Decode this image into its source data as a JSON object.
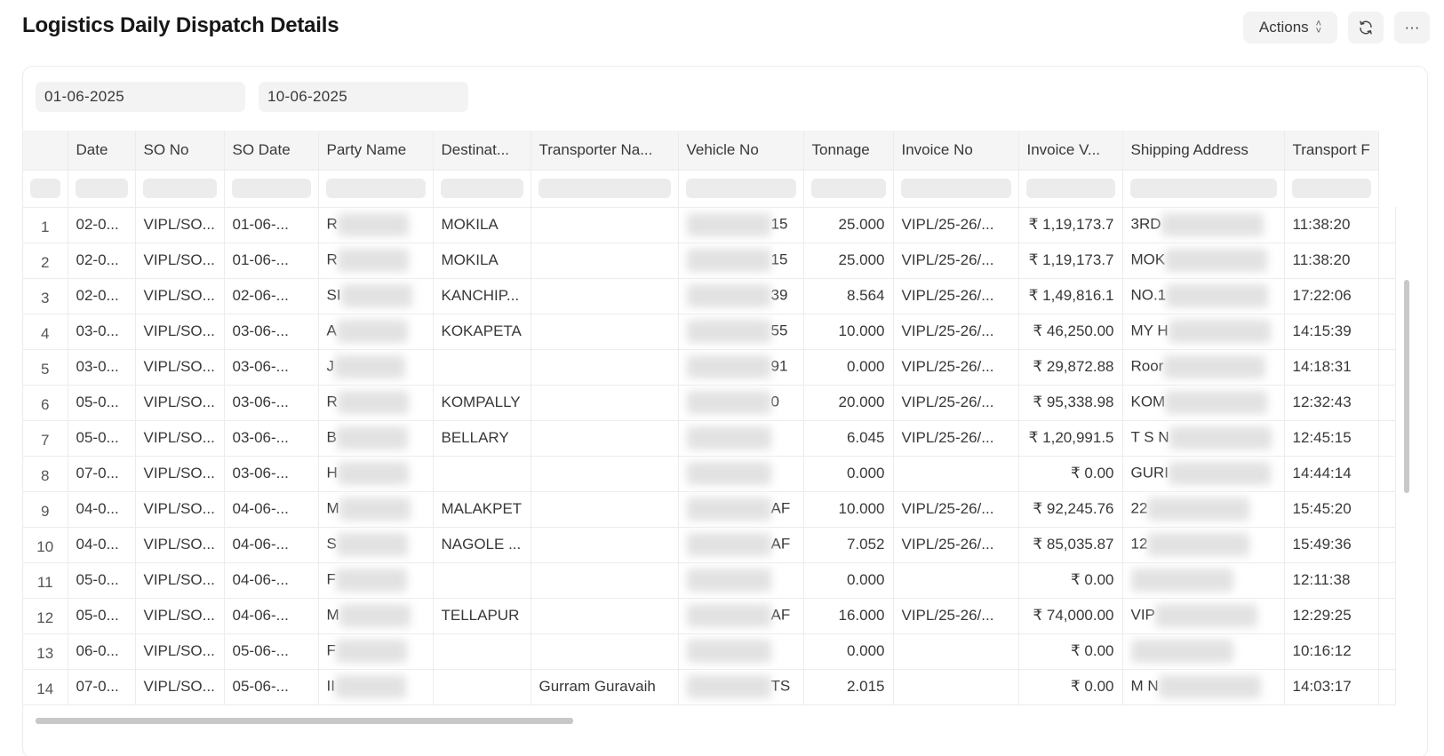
{
  "page": {
    "title": "Logistics Daily Dispatch Details"
  },
  "toolbar": {
    "actions_label": "Actions",
    "refresh_icon": "refresh-icon",
    "more_label": "···"
  },
  "filters": {
    "from_date": "01-06-2025",
    "to_date": "10-06-2025"
  },
  "columns": [
    "Date",
    "SO No",
    "SO Date",
    "Party Name",
    "Destinat...",
    "Transporter Na...",
    "Vehicle No",
    "Tonnage",
    "Invoice No",
    "Invoice V...",
    "Shipping Address",
    "Transport F"
  ],
  "rows": [
    {
      "idx": "1",
      "date": "02-0...",
      "so_no": "VIPL/SO...",
      "so_date": "01-06-...",
      "party": "R",
      "dest": "MOKILA",
      "transporter": "",
      "vehicle": "15",
      "tonnage": "25.000",
      "invoice_no": "VIPL/25-26/...",
      "invoice_val": "₹ 1,19,173.7",
      "address": "3RD",
      "time": "11:38:20"
    },
    {
      "idx": "2",
      "date": "02-0...",
      "so_no": "VIPL/SO...",
      "so_date": "01-06-...",
      "party": "R",
      "dest": "MOKILA",
      "transporter": "",
      "vehicle": "15",
      "tonnage": "25.000",
      "invoice_no": "VIPL/25-26/...",
      "invoice_val": "₹ 1,19,173.7",
      "address": "MOK",
      "time": "11:38:20"
    },
    {
      "idx": "3",
      "date": "02-0...",
      "so_no": "VIPL/SO...",
      "so_date": "02-06-...",
      "party": "SI",
      "dest": "KANCHIP...",
      "transporter": "",
      "vehicle": "39",
      "tonnage": "8.564",
      "invoice_no": "VIPL/25-26/...",
      "invoice_val": "₹ 1,49,816.1",
      "address": "NO.1",
      "time": "17:22:06"
    },
    {
      "idx": "4",
      "date": "03-0...",
      "so_no": "VIPL/SO...",
      "so_date": "03-06-...",
      "party": "A",
      "dest": "KOKAPETA",
      "transporter": "",
      "vehicle": "55",
      "tonnage": "10.000",
      "invoice_no": "VIPL/25-26/...",
      "invoice_val": "₹ 46,250.00",
      "address": "MY H",
      "time": "14:15:39"
    },
    {
      "idx": "5",
      "date": "03-0...",
      "so_no": "VIPL/SO...",
      "so_date": "03-06-...",
      "party": "J",
      "dest": "",
      "transporter": "",
      "vehicle": "91",
      "tonnage": "0.000",
      "invoice_no": "VIPL/25-26/...",
      "invoice_val": "₹ 29,872.88",
      "address": "Roor",
      "time": "14:18:31"
    },
    {
      "idx": "6",
      "date": "05-0...",
      "so_no": "VIPL/SO...",
      "so_date": "03-06-...",
      "party": "R",
      "dest": "KOMPALLY",
      "transporter": "",
      "vehicle": "0",
      "tonnage": "20.000",
      "invoice_no": "VIPL/25-26/...",
      "invoice_val": "₹ 95,338.98",
      "address": "KOM",
      "time": "12:32:43"
    },
    {
      "idx": "7",
      "date": "05-0...",
      "so_no": "VIPL/SO...",
      "so_date": "03-06-...",
      "party": "B",
      "dest": "BELLARY",
      "transporter": "",
      "vehicle": "",
      "tonnage": "6.045",
      "invoice_no": "VIPL/25-26/...",
      "invoice_val": "₹ 1,20,991.5",
      "address": "T S N",
      "time": "12:45:15"
    },
    {
      "idx": "8",
      "date": "07-0...",
      "so_no": "VIPL/SO...",
      "so_date": "03-06-...",
      "party": "H",
      "dest": "",
      "transporter": "",
      "vehicle": "",
      "tonnage": "0.000",
      "invoice_no": "",
      "invoice_val": "₹ 0.00",
      "address": "GURI",
      "time": "14:44:14"
    },
    {
      "idx": "9",
      "date": "04-0...",
      "so_no": "VIPL/SO...",
      "so_date": "04-06-...",
      "party": "M",
      "dest": "MALAKPET",
      "transporter": "",
      "vehicle": "AF",
      "tonnage": "10.000",
      "invoice_no": "VIPL/25-26/...",
      "invoice_val": "₹ 92,245.76",
      "address": "22",
      "time": "15:45:20"
    },
    {
      "idx": "10",
      "date": "04-0...",
      "so_no": "VIPL/SO...",
      "so_date": "04-06-...",
      "party": "S",
      "dest": "NAGOLE ...",
      "transporter": "",
      "vehicle": "AF",
      "tonnage": "7.052",
      "invoice_no": "VIPL/25-26/...",
      "invoice_val": "₹ 85,035.87",
      "address": "12",
      "time": "15:49:36"
    },
    {
      "idx": "11",
      "date": "05-0...",
      "so_no": "VIPL/SO...",
      "so_date": "04-06-...",
      "party": "F",
      "dest": "",
      "transporter": "",
      "vehicle": "",
      "tonnage": "0.000",
      "invoice_no": "",
      "invoice_val": "₹ 0.00",
      "address": "",
      "time": "12:11:38"
    },
    {
      "idx": "12",
      "date": "05-0...",
      "so_no": "VIPL/SO...",
      "so_date": "04-06-...",
      "party": "M",
      "dest": "TELLAPUR",
      "transporter": "",
      "vehicle": "AF",
      "tonnage": "16.000",
      "invoice_no": "VIPL/25-26/...",
      "invoice_val": "₹ 74,000.00",
      "address": "VIP",
      "time": "12:29:25"
    },
    {
      "idx": "13",
      "date": "06-0...",
      "so_no": "VIPL/SO...",
      "so_date": "05-06-...",
      "party": "F",
      "dest": "",
      "transporter": "",
      "vehicle": "",
      "tonnage": "0.000",
      "invoice_no": "",
      "invoice_val": "₹ 0.00",
      "address": "",
      "time": "10:16:12"
    },
    {
      "idx": "14",
      "date": "07-0...",
      "so_no": "VIPL/SO...",
      "so_date": "05-06-...",
      "party": "II",
      "dest": "",
      "transporter": "Gurram Guravaih",
      "vehicle": "TS",
      "tonnage": "2.015",
      "invoice_no": "",
      "invoice_val": "₹ 0.00",
      "address": "M N",
      "time": "14:03:17"
    }
  ],
  "colors": {
    "header_bg": "#f5f5f5",
    "border": "#ececec",
    "text": "#383838"
  }
}
